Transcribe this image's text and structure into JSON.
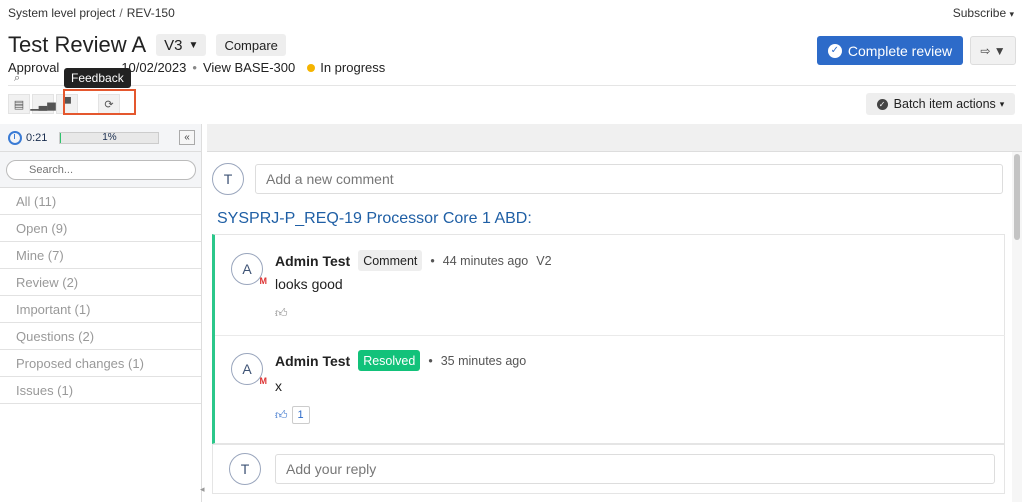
{
  "breadcrumb": {
    "project": "System level project",
    "separator": "/",
    "review_id": "REV-150"
  },
  "header": {
    "subscribe": "Subscribe",
    "title": "Test Review A",
    "version": "V3",
    "compare": "Compare",
    "meta_prefix": "Approval",
    "date": "10/02/2023",
    "baseline": "View BASE-300",
    "status": "In progress",
    "status_color": "#f5b400",
    "complete_label": "Complete review",
    "batch_label": "Batch item actions"
  },
  "toolbar": {
    "tooltip": "Feedback",
    "icons": [
      "document-icon",
      "chart-icon",
      "comment-icon",
      "refresh-icon"
    ]
  },
  "left_panel": {
    "timer": "0:21",
    "progress_label": "1%",
    "progress_value": 0.01,
    "search_placeholder": "Search...",
    "filters": [
      {
        "label": "All (11)"
      },
      {
        "label": "Open (9)"
      },
      {
        "label": "Mine (7)"
      },
      {
        "label": "Review (2)"
      },
      {
        "label": "Important (1)"
      },
      {
        "label": "Questions (2)"
      },
      {
        "label": "Proposed changes (1)"
      },
      {
        "label": "Issues (1)"
      }
    ]
  },
  "main": {
    "new_comment_avatar": "T",
    "new_comment_placeholder": "Add a new comment",
    "requirement_title": "SYSPRJ-P_REQ-19 Processor Core 1 ABD:",
    "comments": [
      {
        "avatar": "A",
        "avatar_badge": "M",
        "author": "Admin Test",
        "badge": "Comment",
        "time": "44 minutes ago",
        "version": "V2",
        "text": "looks good",
        "likes": ""
      },
      {
        "avatar": "A",
        "avatar_badge": "M",
        "author": "Admin Test",
        "badge": "Resolved",
        "time": "35 minutes ago",
        "version": "",
        "text": "x",
        "likes": "1"
      }
    ],
    "reply_avatar": "T",
    "reply_placeholder": "Add your reply",
    "accent_green": "#2bc78a",
    "accent_blue": "#2d6bc9"
  }
}
